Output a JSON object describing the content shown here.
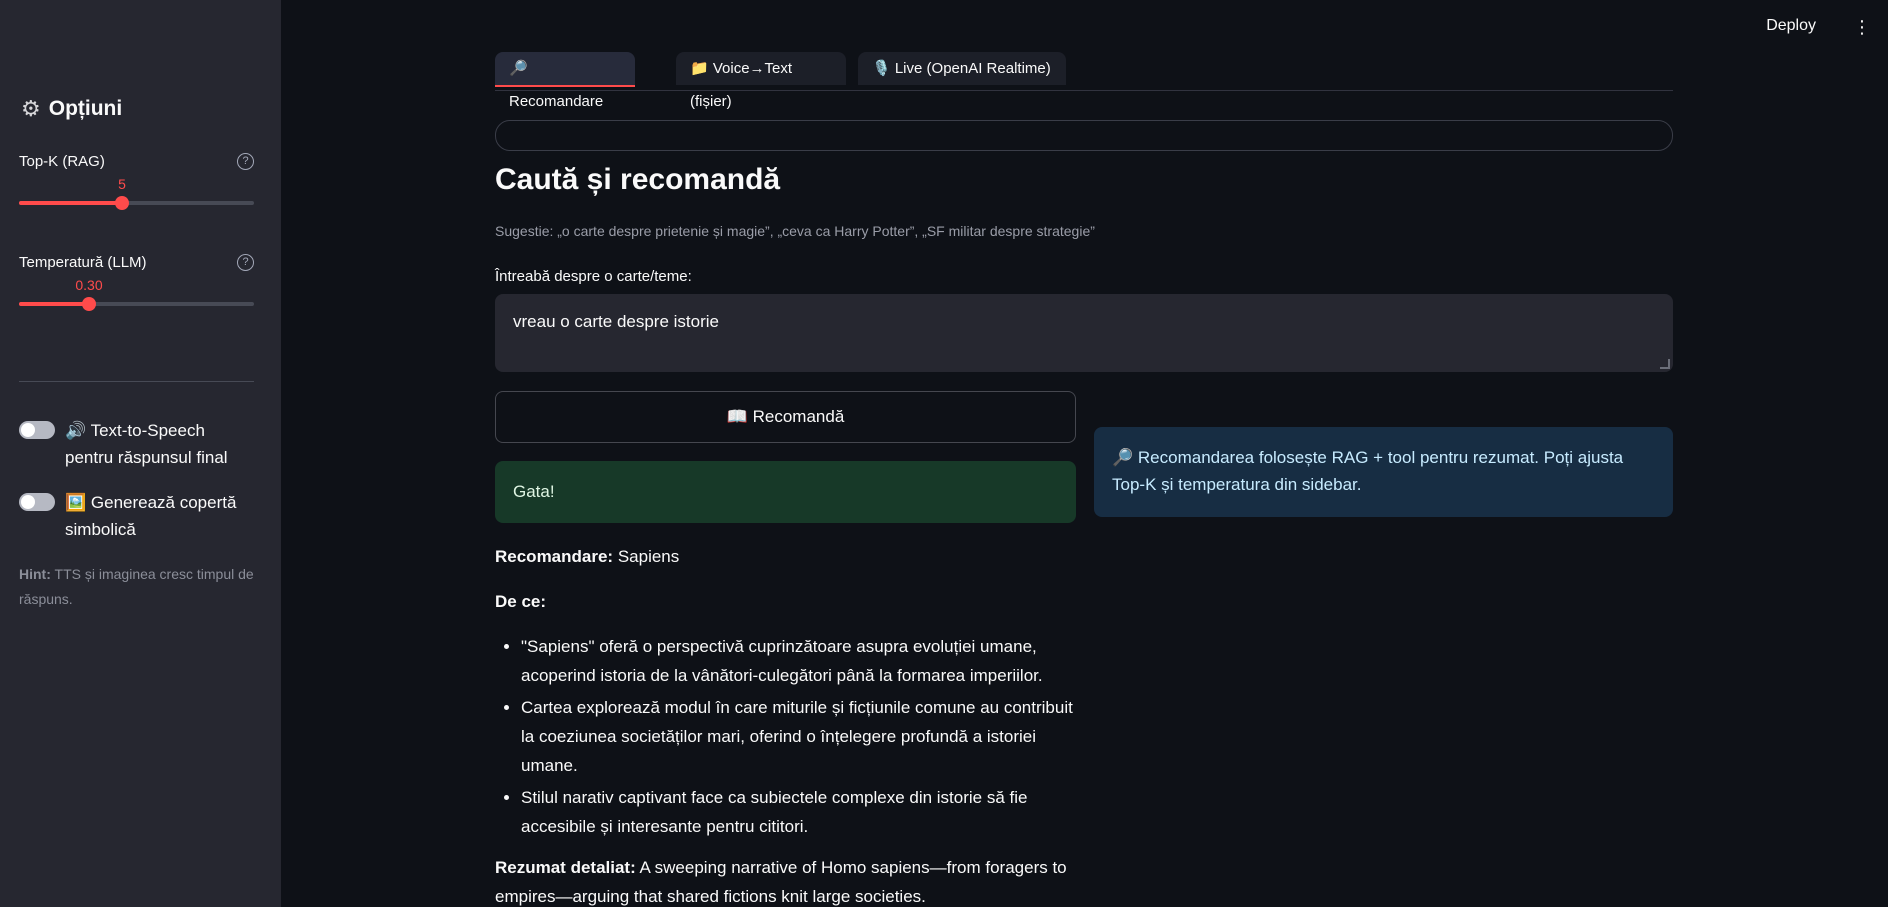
{
  "header": {
    "deploy_label": "Deploy",
    "menu_icon": "kebab-menu-icon"
  },
  "sidebar": {
    "title": "Opțiuni",
    "title_icon": "gear-icon",
    "sliders": [
      {
        "label": "Top-K (RAG)",
        "value_text": "5",
        "value": 5,
        "min": 1,
        "max": 11,
        "help_icon": "question-circle-icon"
      },
      {
        "label": "Temperatură (LLM)",
        "value_text": "0.30",
        "value": 0.3,
        "min": 0.0,
        "max": 1.0,
        "help_icon": "question-circle-icon"
      }
    ],
    "toggles": [
      {
        "label": "🔊 Text-to-Speech pentru răspunsul final",
        "on": false
      },
      {
        "label": "🖼️ Generează copertă simbolică",
        "on": false
      }
    ],
    "hint_bold": "Hint:",
    "hint_text": " TTS și imaginea cresc timpul de răspuns."
  },
  "main": {
    "tabs": [
      {
        "label": "🔎Recomandare (text)",
        "active": true
      },
      {
        "label": "📁 Voice→Text (fișier)",
        "active": false
      },
      {
        "label": "🎙️ Live (OpenAI Realtime)",
        "active": false
      }
    ],
    "page_title": "Caută și recomandă",
    "suggestion": "Sugestie: „o carte despre prietenie și magie”, „ceva ca Harry Potter”, „SF militar despre strategie”",
    "input_label": "Întreabă despre o carte/teme:",
    "input_value": "vreau o carte despre istorie",
    "recommend_button": "📖 Recomandă",
    "success_message": "Gata!",
    "info_message": "🔎 Recomandarea folosește RAG + tool pentru rezumat. Poți ajusta Top-K și temperatura din sidebar.",
    "result": {
      "recommendation_label": "Recomandare:",
      "recommendation_value": " Sapiens",
      "why_label": "De ce:",
      "reasons": [
        "\"Sapiens\" oferă o perspectivă cuprinzătoare asupra evoluției umane, acoperind istoria de la vânători-culegători până la formarea imperiilor.",
        "Cartea explorează modul în care miturile și ficțiunile comune au contribuit la coeziunea societăților mari, oferind o înțelegere profundă a istoriei umane.",
        "Stilul narativ captivant face ca subiectele complexe din istorie să fie accesibile și interesante pentru cititori."
      ],
      "summary_label": "Rezumat detaliat:",
      "summary_text": " A sweeping narrative of Homo sapiens—from foragers to empires—arguing that shared fictions knit large societies."
    }
  },
  "colors": {
    "accent": "#ff4b4b",
    "background": "#0e1117",
    "sidebar": "#262730",
    "success_bg": "#173928",
    "info_bg": "#172d43"
  }
}
